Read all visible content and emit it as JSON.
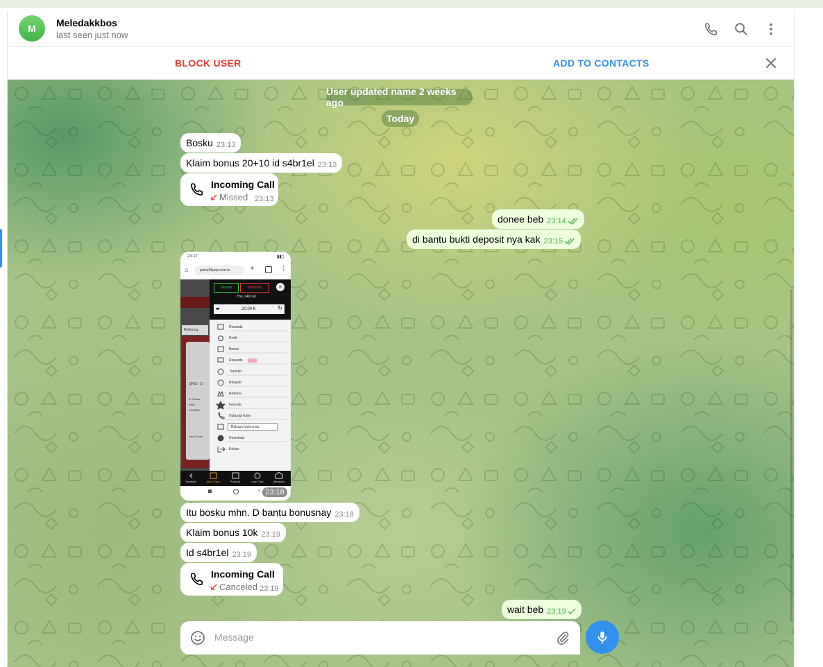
{
  "header": {
    "avatar_letter": "M",
    "name": "Meledakkbos",
    "status": "last seen just now"
  },
  "actions": {
    "block": "BLOCK USER",
    "add": "ADD TO CONTACTS"
  },
  "service": {
    "updated": "User updated name 2 weeks ago",
    "today": "Today"
  },
  "messages": {
    "m1": {
      "text": "Bosku",
      "time": "23:13"
    },
    "m2": {
      "text": "Klaim bonus 20+10 id s4br1el",
      "time": "23:13"
    },
    "call1": {
      "title": "Incoming Call",
      "status": "Missed",
      "time": "23:13"
    },
    "o1": {
      "text": "donee beb",
      "time": "23:14"
    },
    "o2": {
      "text": "di bantu bukti deposit nya kak",
      "time": "23:15"
    },
    "photo": {
      "time": "23:18"
    },
    "m3": {
      "text": "Itu bosku mhn. D bantu bonusnay",
      "time": "23:18"
    },
    "m4": {
      "text": "Klaim bonus 10k",
      "time": "23:19"
    },
    "m5": {
      "text": "Id s4br1el",
      "time": "23:19"
    },
    "call2": {
      "title": "Incoming Call",
      "status": "Canceled",
      "time": "23:19"
    },
    "o3": {
      "text": "wait beb",
      "time": "23:19"
    }
  },
  "screenshot": {
    "clock": "23:17",
    "url": "prime55pop.com.co",
    "deposit": "Deposit",
    "withdraw": "Withdraw",
    "greeting": "Hai,  s4br1el",
    "balance": "20.00 K",
    "menu": [
      "Rewards",
      "Profil",
      "Bonus",
      "Rewards",
      "Transfer",
      "Riwayat",
      "Referral",
      "Favorite",
      "Hubungi Kami",
      "Bahasa Indonesia",
      "Download",
      "Keluar"
    ],
    "side_texts": [
      "Referring",
      "QRIS - D",
      "D Transa",
      "9565",
      "7334855",
      "Total Pemb"
    ],
    "bottom_nav": [
      "Kembali",
      "Akun Saya",
      "Promosi",
      "Live Chat",
      "Beranda"
    ]
  },
  "composer": {
    "placeholder": "Message"
  },
  "colors": {
    "accent": "#3390ec",
    "danger": "#e53935",
    "outgoing_bubble": "#eeffde",
    "missed": "#e53935",
    "check": "#4fae4e"
  }
}
